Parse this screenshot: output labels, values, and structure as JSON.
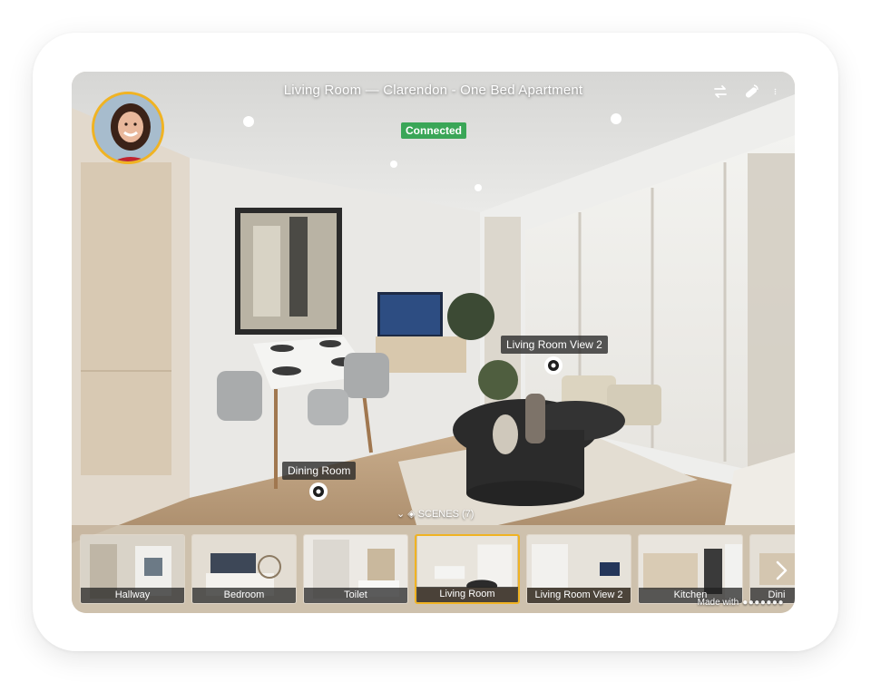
{
  "tour": {
    "title": "Living Room — Clarendon - One Bed Apartment",
    "status": "Connected"
  },
  "colors": {
    "accent": "#f0b323",
    "status_green": "#3aa657"
  },
  "toolbar": {
    "icons": [
      "swap-icon",
      "share-link-icon",
      "more-options-icon"
    ]
  },
  "hotspots": {
    "dining_room": "Dining Room",
    "living_room_view_2": "Living Room View 2"
  },
  "scenes": {
    "toggle_label": "SCENES (7)",
    "items": [
      {
        "label": "Hallway"
      },
      {
        "label": "Bedroom"
      },
      {
        "label": "Toilet"
      },
      {
        "label": "Living Room",
        "active": true
      },
      {
        "label": "Living Room View 2"
      },
      {
        "label": "Kitchen"
      },
      {
        "label": "Dini"
      }
    ]
  },
  "footer": {
    "made_with": "Made with"
  }
}
